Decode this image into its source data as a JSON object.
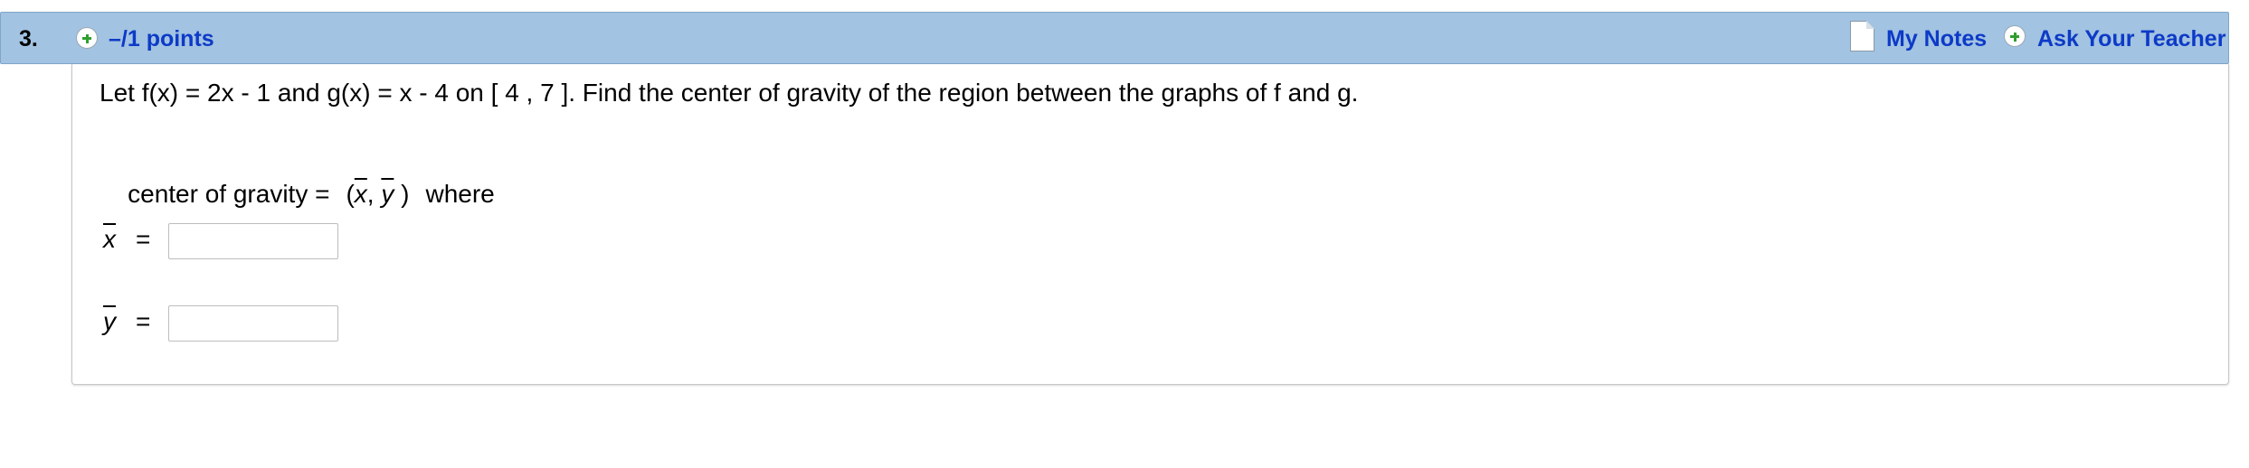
{
  "header": {
    "question_number": "3.",
    "points_label": "–/1 points",
    "my_notes_label": "My Notes",
    "ask_teacher_label": "Ask Your Teacher"
  },
  "question": {
    "prompt": "Let f(x) = 2x - 1 and g(x) = x - 4 on [ 4 , 7 ]. Find the center of gravity of the region between the graphs of f and g.",
    "cog_label": "center of gravity =",
    "cog_open": "(",
    "cog_x": "x",
    "cog_sep": ", ",
    "cog_y": "y",
    "cog_close": " )",
    "cog_where": "where"
  },
  "answers": {
    "x_label": "x",
    "y_label": "y",
    "equals": "=",
    "x_value": "",
    "y_value": ""
  },
  "colors": {
    "header_bg": "#a2c3e1",
    "link": "#0d3ac7",
    "plus_icon": "#2f9e2f"
  },
  "icons": {
    "points": "plus-circle-icon",
    "notes": "note-page-icon",
    "teacher": "plus-circle-icon"
  }
}
